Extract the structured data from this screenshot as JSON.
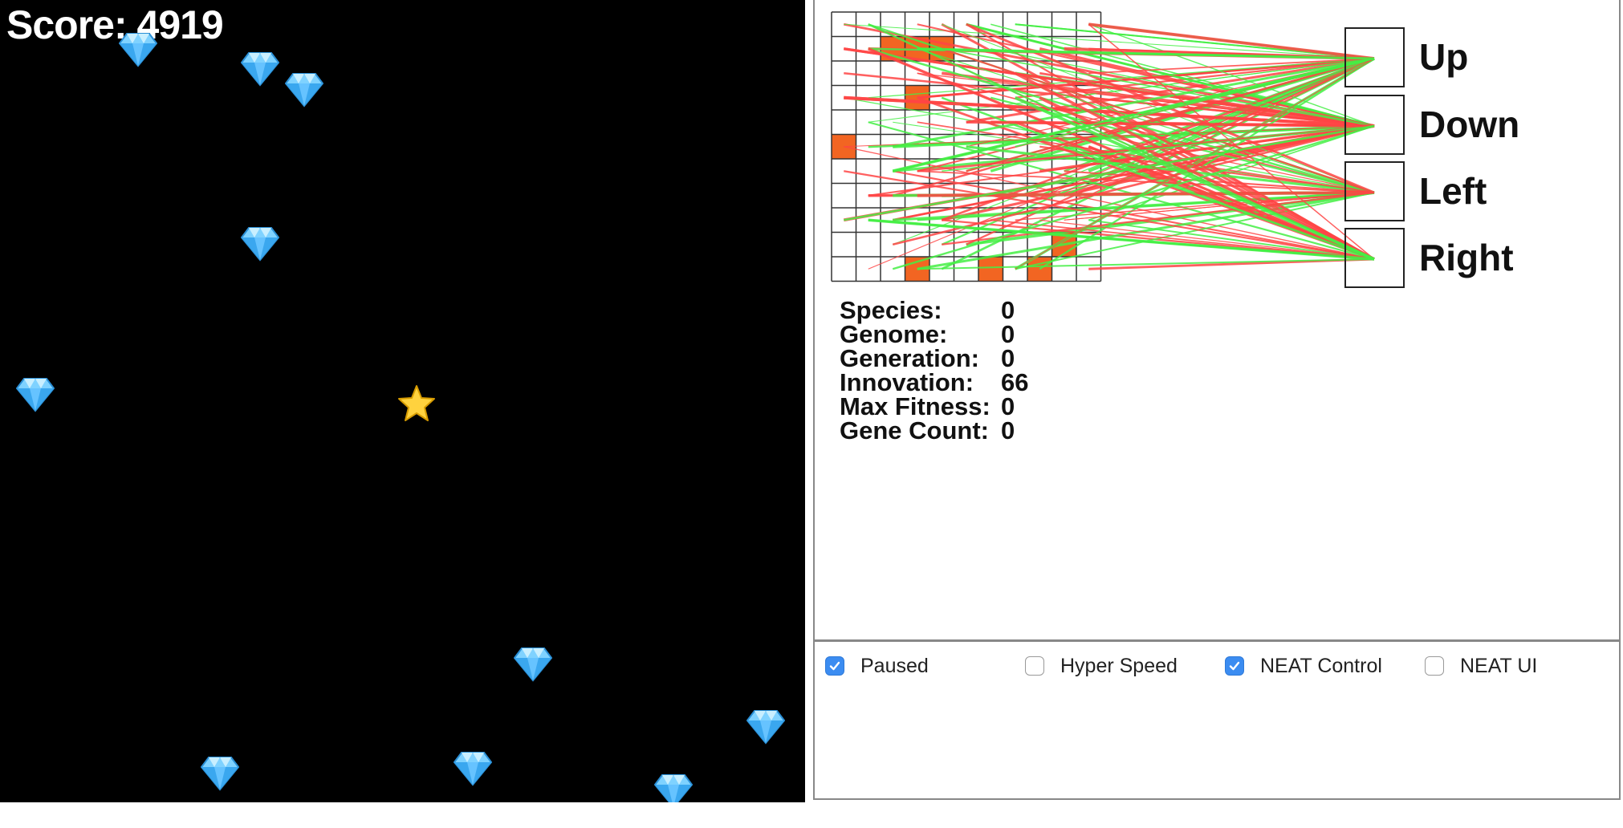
{
  "game": {
    "score_text": "Score: 4919",
    "gem_count": 11,
    "player_icon": "star-icon",
    "item_icon": "gem-icon"
  },
  "network": {
    "outputs": [
      "Up",
      "Down",
      "Left",
      "Right"
    ],
    "colors": {
      "positive": "#44ee44",
      "negative": "#ff4444",
      "active_cell": "#f26522"
    },
    "grid_size": [
      11,
      11
    ]
  },
  "stats": [
    {
      "label": "Species:",
      "value": "0"
    },
    {
      "label": "Genome:",
      "value": "0"
    },
    {
      "label": "Generation:",
      "value": "0"
    },
    {
      "label": "Innovation:",
      "value": "66"
    },
    {
      "label": "Max Fitness:",
      "value": "0"
    },
    {
      "label": "Gene Count:",
      "value": "0"
    }
  ],
  "controls": [
    {
      "label": "Paused",
      "checked": true
    },
    {
      "label": "Hyper Speed",
      "checked": false
    },
    {
      "label": "NEAT Control",
      "checked": true
    },
    {
      "label": "NEAT UI",
      "checked": false
    }
  ]
}
